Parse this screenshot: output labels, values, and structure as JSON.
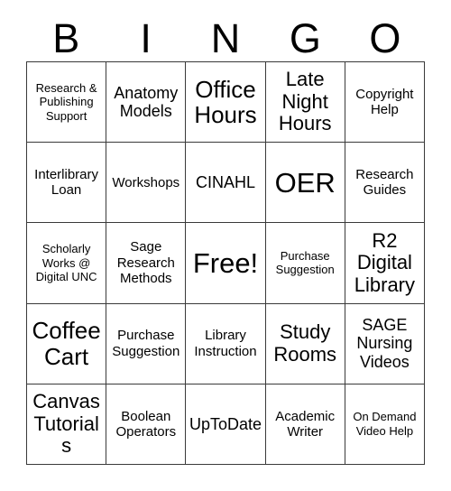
{
  "card": {
    "title": "BINGO",
    "header_letters": [
      "B",
      "I",
      "N",
      "G",
      "O"
    ],
    "colors": {
      "text": "#000000",
      "border": "#3a3a3a",
      "background": "#ffffff"
    },
    "grid": {
      "columns": 5,
      "rows": 5,
      "free_space_index": 12
    },
    "cells": [
      {
        "label": "Research & Publishing Support",
        "size": "xs"
      },
      {
        "label": "Anatomy Models",
        "size": "md"
      },
      {
        "label": "Office Hours",
        "size": "xl"
      },
      {
        "label": "Late Night Hours",
        "size": "lg"
      },
      {
        "label": "Copyright Help",
        "size": "sm"
      },
      {
        "label": "Interlibrary Loan",
        "size": "sm"
      },
      {
        "label": "Workshops",
        "size": "sm"
      },
      {
        "label": "CINAHL",
        "size": "md"
      },
      {
        "label": "OER",
        "size": "xxl"
      },
      {
        "label": "Research Guides",
        "size": "sm"
      },
      {
        "label": "Scholarly Works @ Digital UNC",
        "size": "xs"
      },
      {
        "label": "Sage Research Methods",
        "size": "sm"
      },
      {
        "label": "Free!",
        "size": "xxl"
      },
      {
        "label": "Purchase Suggestion",
        "size": "xs"
      },
      {
        "label": "R2 Digital Library",
        "size": "lg"
      },
      {
        "label": "Coffee Cart",
        "size": "xl"
      },
      {
        "label": "Purchase Suggestion",
        "size": "sm"
      },
      {
        "label": "Library Instruction",
        "size": "sm"
      },
      {
        "label": "Study Rooms",
        "size": "lg"
      },
      {
        "label": "SAGE Nursing Videos",
        "size": "md"
      },
      {
        "label": "Canvas Tutorials",
        "size": "lg"
      },
      {
        "label": "Boolean Operators",
        "size": "sm"
      },
      {
        "label": "UpToDate",
        "size": "md"
      },
      {
        "label": "Academic Writer",
        "size": "sm"
      },
      {
        "label": "On Demand Video Help",
        "size": "xs"
      }
    ]
  }
}
